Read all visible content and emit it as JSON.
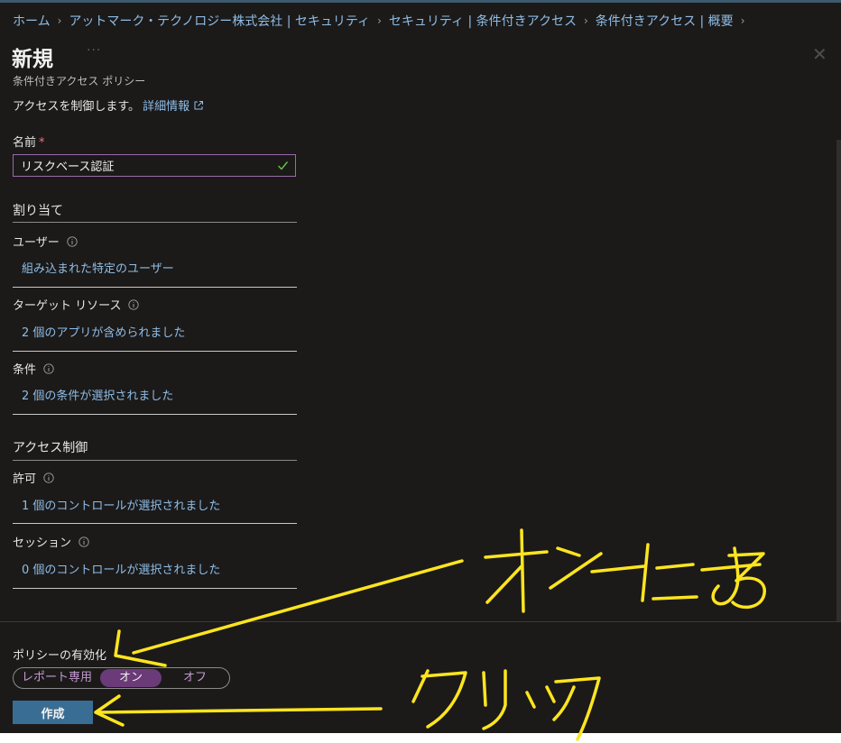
{
  "breadcrumb": [
    {
      "label": "ホーム"
    },
    {
      "label": "アットマーク・テクノロジー株式会社 | セキュリティ"
    },
    {
      "label": "セキュリティ | 条件付きアクセス"
    },
    {
      "label": "条件付きアクセス | 概要"
    }
  ],
  "header": {
    "title": "新規",
    "more": "···",
    "close": "✕",
    "subtitle": "条件付きアクセス ポリシー",
    "description": "アクセスを制御します。",
    "learn_more": "詳細情報"
  },
  "name_field": {
    "label": "名前",
    "required_mark": "*",
    "value": "リスクベース認証"
  },
  "assignments": {
    "heading": "割り当て",
    "users": {
      "label": "ユーザー",
      "value": "組み込まれた特定のユーザー"
    },
    "target_resources": {
      "label": "ターゲット リソース",
      "value": "2 個のアプリが含められました"
    },
    "conditions": {
      "label": "条件",
      "value": "2 個の条件が選択されました"
    }
  },
  "access_controls": {
    "heading": "アクセス制御",
    "grant": {
      "label": "許可",
      "value": "1 個のコントロールが選択されました"
    },
    "session": {
      "label": "セッション",
      "value": "0 個のコントロールが選択されました"
    }
  },
  "policy_enable": {
    "label": "ポリシーの有効化",
    "options": [
      "レポート専用",
      "オン",
      "オフ"
    ],
    "selected": "オン"
  },
  "create_button": {
    "label": "作成"
  },
  "colors": {
    "background": "#1b1a19",
    "link": "#8fbce6",
    "toggle_selected": "#6b3a78",
    "primary_button": "#3a6d94",
    "annotation": "#ffe51e"
  }
}
